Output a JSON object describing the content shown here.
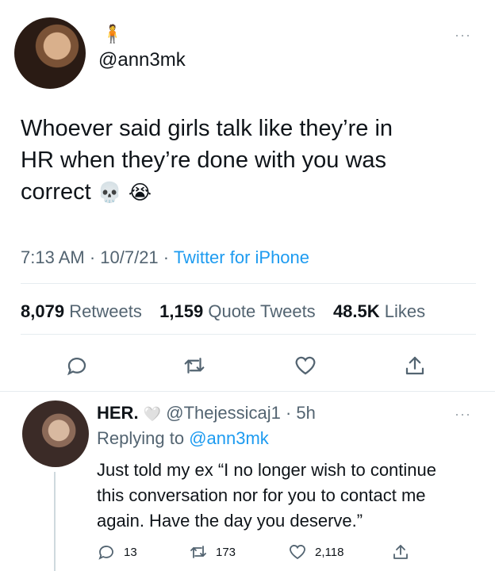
{
  "tweet": {
    "username": "@ann3mk",
    "text_line1": "Whoever said girls talk like they’re in",
    "text_line2": "HR when they’re done with you was",
    "text_line3": "correct",
    "emoji1": "💀",
    "emoji2": "😭",
    "timestamp": "7:13 AM · 10/7/21 · ",
    "source": "Twitter for iPhone",
    "retweets_count": "8,079",
    "retweets_label": "Retweets",
    "quotes_count": "1,159",
    "quotes_label": "Quote Tweets",
    "likes_count": "48.5K",
    "likes_label": "Likes",
    "more": "···",
    "top_emoji": "🧍"
  },
  "reply": {
    "display_name": "HER.",
    "name_emoji": "🤍",
    "handle": "@Thejessicaj1 · 5h",
    "replying_prefix": "Replying to ",
    "replying_to": "@ann3mk",
    "text_line1": "Just told my ex “I no longer wish to continue",
    "text_line2": "this conversation nor for you to contact me",
    "text_line3": "again. Have the day you deserve.”",
    "comments": "13",
    "retweets": "173",
    "likes": "2,118",
    "more": "···"
  },
  "icons": {
    "reply": "reply-icon",
    "retweet": "retweet-icon",
    "like": "heart-icon",
    "share": "share-icon"
  }
}
